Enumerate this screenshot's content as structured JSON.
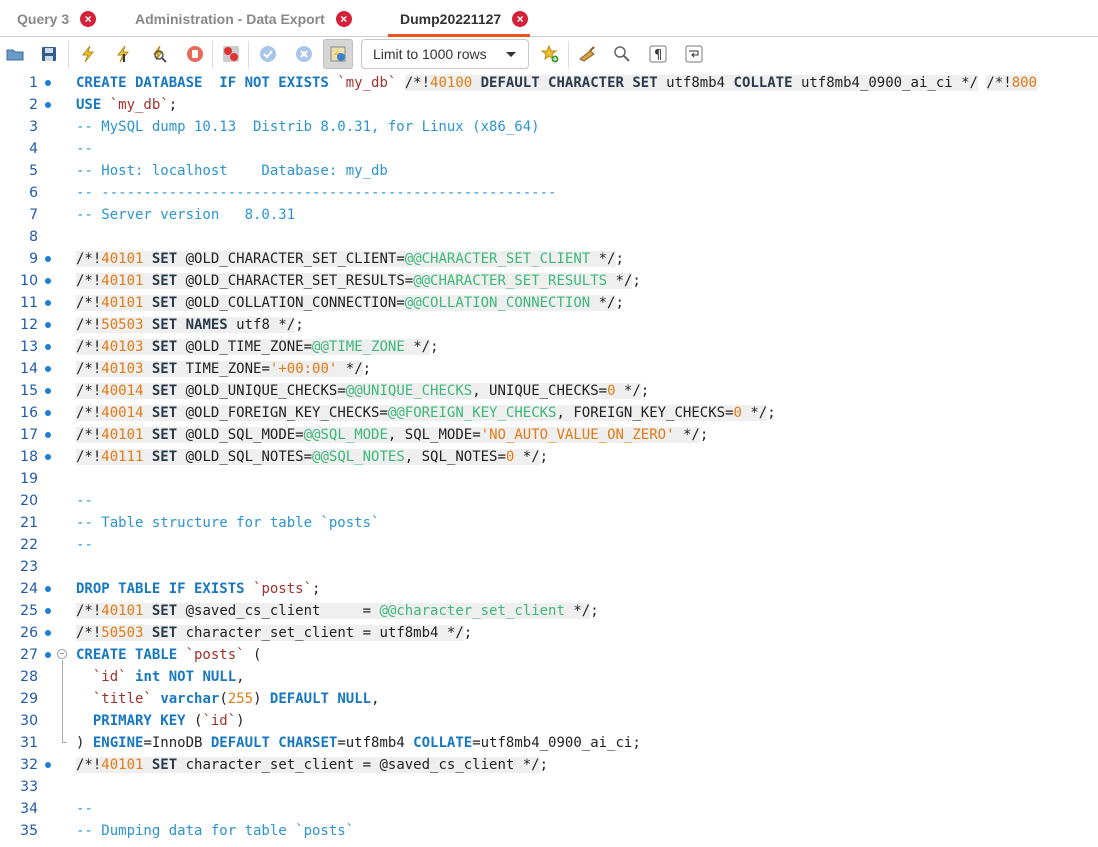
{
  "tabs": [
    {
      "label": "Query 3",
      "active": false
    },
    {
      "label": "Administration - Data Export",
      "active": false
    },
    {
      "label": "Dump20221127",
      "active": true
    }
  ],
  "toolbar": {
    "icons": [
      "open-folder-icon",
      "save-icon",
      "execute-icon",
      "execute-current-icon",
      "explain-icon",
      "stop-icon",
      "toggle-error-stop-icon",
      "commit-icon",
      "rollback-icon",
      "autocommit-icon"
    ],
    "limit_label": "Limit to 1000 rows",
    "right_icons": [
      "add-snippet-icon",
      "beautify-icon",
      "find-icon",
      "invisible-chars-icon",
      "wrap-icon"
    ]
  },
  "editor": {
    "lines": [
      {
        "n": "1",
        "dot": true,
        "segs": [
          [
            "kw",
            "CREATE DATABASE  IF NOT EXISTS "
          ],
          [
            "str",
            "`my_db`"
          ],
          [
            "op",
            " "
          ],
          [
            "hlc",
            "/*!"
          ],
          [
            "hlv",
            "40100"
          ],
          [
            "hlk",
            " DEFAULT CHARACTER SET "
          ],
          [
            "hlp",
            "utf8mb4 "
          ],
          [
            "hlk",
            "COLLATE "
          ],
          [
            "hlp",
            "utf8mb4_0900_ai_ci */"
          ],
          [
            "op",
            " "
          ],
          [
            "hlc",
            "/*!"
          ],
          [
            "hlv",
            "800"
          ]
        ]
      },
      {
        "n": "2",
        "dot": true,
        "segs": [
          [
            "kw",
            "USE "
          ],
          [
            "str",
            "`my_db`"
          ],
          [
            "op",
            ";"
          ]
        ]
      },
      {
        "n": "3",
        "dot": false,
        "segs": [
          [
            "cm",
            "-- MySQL dump 10.13  Distrib 8.0.31, for Linux (x86_64)"
          ]
        ]
      },
      {
        "n": "4",
        "dot": false,
        "segs": [
          [
            "cm",
            "--"
          ]
        ]
      },
      {
        "n": "5",
        "dot": false,
        "segs": [
          [
            "cm",
            "-- Host: localhost    Database: my_db"
          ]
        ]
      },
      {
        "n": "6",
        "dot": false,
        "segs": [
          [
            "cm",
            "-- ------------------------------------------------------"
          ]
        ]
      },
      {
        "n": "7",
        "dot": false,
        "segs": [
          [
            "cm",
            "-- Server version\t8.0.31"
          ]
        ]
      },
      {
        "n": "8",
        "dot": false,
        "segs": []
      },
      {
        "n": "9",
        "dot": true,
        "segs": [
          [
            "hlc",
            "/*!"
          ],
          [
            "hlv",
            "40101"
          ],
          [
            "hlk",
            " SET "
          ],
          [
            "hlp",
            "@OLD_CHARACTER_SET_CLIENT="
          ],
          [
            "hls",
            "@@CHARACTER_SET_CLIENT"
          ],
          [
            "hlp",
            " */"
          ],
          [
            "op",
            ";"
          ]
        ]
      },
      {
        "n": "10",
        "dot": true,
        "segs": [
          [
            "hlc",
            "/*!"
          ],
          [
            "hlv",
            "40101"
          ],
          [
            "hlk",
            " SET "
          ],
          [
            "hlp",
            "@OLD_CHARACTER_SET_RESULTS="
          ],
          [
            "hls",
            "@@CHARACTER_SET_RESULTS"
          ],
          [
            "hlp",
            " */"
          ],
          [
            "op",
            ";"
          ]
        ]
      },
      {
        "n": "11",
        "dot": true,
        "segs": [
          [
            "hlc",
            "/*!"
          ],
          [
            "hlv",
            "40101"
          ],
          [
            "hlk",
            " SET "
          ],
          [
            "hlp",
            "@OLD_COLLATION_CONNECTION="
          ],
          [
            "hls",
            "@@COLLATION_CONNECTION"
          ],
          [
            "hlp",
            " */"
          ],
          [
            "op",
            ";"
          ]
        ]
      },
      {
        "n": "12",
        "dot": true,
        "segs": [
          [
            "hlc",
            "/*!"
          ],
          [
            "hlv",
            "50503"
          ],
          [
            "hlk",
            " SET NAMES "
          ],
          [
            "hlp",
            "utf8 */"
          ],
          [
            "op",
            ";"
          ]
        ]
      },
      {
        "n": "13",
        "dot": true,
        "segs": [
          [
            "hlc",
            "/*!"
          ],
          [
            "hlv",
            "40103"
          ],
          [
            "hlk",
            " SET "
          ],
          [
            "hlp",
            "@OLD_TIME_ZONE="
          ],
          [
            "hls",
            "@@TIME_ZONE"
          ],
          [
            "hlp",
            " */"
          ],
          [
            "op",
            ";"
          ]
        ]
      },
      {
        "n": "14",
        "dot": true,
        "segs": [
          [
            "hlc",
            "/*!"
          ],
          [
            "hlv",
            "40103"
          ],
          [
            "hlk",
            " SET "
          ],
          [
            "hlp",
            "TIME_ZONE="
          ],
          [
            "hlv",
            "'+00:00'"
          ],
          [
            "hlp",
            " */"
          ],
          [
            "op",
            ";"
          ]
        ]
      },
      {
        "n": "15",
        "dot": true,
        "segs": [
          [
            "hlc",
            "/*!"
          ],
          [
            "hlv",
            "40014"
          ],
          [
            "hlk",
            " SET "
          ],
          [
            "hlp",
            "@OLD_UNIQUE_CHECKS="
          ],
          [
            "hls",
            "@@UNIQUE_CHECKS"
          ],
          [
            "hlp",
            ", UNIQUE_CHECKS="
          ],
          [
            "hlv",
            "0"
          ],
          [
            "hlp",
            " */"
          ],
          [
            "op",
            ";"
          ]
        ]
      },
      {
        "n": "16",
        "dot": true,
        "segs": [
          [
            "hlc",
            "/*!"
          ],
          [
            "hlv",
            "40014"
          ],
          [
            "hlk",
            " SET "
          ],
          [
            "hlp",
            "@OLD_FOREIGN_KEY_CHECKS="
          ],
          [
            "hls",
            "@@FOREIGN_KEY_CHECKS"
          ],
          [
            "hlp",
            ", FOREIGN_KEY_CHECKS="
          ],
          [
            "hlv",
            "0"
          ],
          [
            "hlp",
            " */"
          ],
          [
            "op",
            ";"
          ]
        ]
      },
      {
        "n": "17",
        "dot": true,
        "segs": [
          [
            "hlc",
            "/*!"
          ],
          [
            "hlv",
            "40101"
          ],
          [
            "hlk",
            " SET "
          ],
          [
            "hlp",
            "@OLD_SQL_MODE="
          ],
          [
            "hls",
            "@@SQL_MODE"
          ],
          [
            "hlp",
            ", SQL_MODE="
          ],
          [
            "hlv",
            "'NO_AUTO_VALUE_ON_ZERO'"
          ],
          [
            "hlp",
            " */"
          ],
          [
            "op",
            ";"
          ]
        ]
      },
      {
        "n": "18",
        "dot": true,
        "segs": [
          [
            "hlc",
            "/*!"
          ],
          [
            "hlv",
            "40111"
          ],
          [
            "hlk",
            " SET "
          ],
          [
            "hlp",
            "@OLD_SQL_NOTES="
          ],
          [
            "hls",
            "@@SQL_NOTES"
          ],
          [
            "hlp",
            ", SQL_NOTES="
          ],
          [
            "hlv",
            "0"
          ],
          [
            "hlp",
            " */"
          ],
          [
            "op",
            ";"
          ]
        ]
      },
      {
        "n": "19",
        "dot": false,
        "segs": []
      },
      {
        "n": "20",
        "dot": false,
        "segs": [
          [
            "cm",
            "--"
          ]
        ]
      },
      {
        "n": "21",
        "dot": false,
        "segs": [
          [
            "cm",
            "-- Table structure for table `posts`"
          ]
        ]
      },
      {
        "n": "22",
        "dot": false,
        "segs": [
          [
            "cm",
            "--"
          ]
        ]
      },
      {
        "n": "23",
        "dot": false,
        "segs": []
      },
      {
        "n": "24",
        "dot": true,
        "segs": [
          [
            "kw",
            "DROP TABLE IF EXISTS "
          ],
          [
            "str",
            "`posts`"
          ],
          [
            "op",
            ";"
          ]
        ]
      },
      {
        "n": "25",
        "dot": true,
        "segs": [
          [
            "hlc",
            "/*!"
          ],
          [
            "hlv",
            "40101"
          ],
          [
            "hlk",
            " SET "
          ],
          [
            "hlp",
            "@saved_cs_client     = "
          ],
          [
            "hls",
            "@@character_set_client"
          ],
          [
            "hlp",
            " */"
          ],
          [
            "op",
            ";"
          ]
        ]
      },
      {
        "n": "26",
        "dot": true,
        "segs": [
          [
            "hlc",
            "/*!"
          ],
          [
            "hlv",
            "50503"
          ],
          [
            "hlk",
            " SET "
          ],
          [
            "hlp",
            "character_set_client = utf8mb4 */"
          ],
          [
            "op",
            ";"
          ]
        ]
      },
      {
        "n": "27",
        "dot": true,
        "fold": true,
        "segs": [
          [
            "kw",
            "CREATE TABLE "
          ],
          [
            "str",
            "`posts`"
          ],
          [
            "op",
            " ("
          ]
        ]
      },
      {
        "n": "28",
        "dot": false,
        "segs": [
          [
            "op",
            "  "
          ],
          [
            "str",
            "`id`"
          ],
          [
            "op",
            " "
          ],
          [
            "kw",
            "int NOT NULL"
          ],
          [
            "op",
            ","
          ]
        ]
      },
      {
        "n": "29",
        "dot": false,
        "segs": [
          [
            "op",
            "  "
          ],
          [
            "str",
            "`title`"
          ],
          [
            "op",
            " "
          ],
          [
            "kw",
            "varchar"
          ],
          [
            "op",
            "("
          ],
          [
            "num",
            "255"
          ],
          [
            "op",
            ") "
          ],
          [
            "kw",
            "DEFAULT NULL"
          ],
          [
            "op",
            ","
          ]
        ]
      },
      {
        "n": "30",
        "dot": false,
        "segs": [
          [
            "op",
            "  "
          ],
          [
            "kw",
            "PRIMARY KEY"
          ],
          [
            "op",
            " ("
          ],
          [
            "str",
            "`id`"
          ],
          [
            "op",
            ")"
          ]
        ]
      },
      {
        "n": "31",
        "dot": false,
        "segs": [
          [
            "op",
            ") "
          ],
          [
            "kw",
            "ENGINE"
          ],
          [
            "op",
            "=InnoDB "
          ],
          [
            "kw",
            "DEFAULT CHARSET"
          ],
          [
            "op",
            "=utf8mb4 "
          ],
          [
            "kw",
            "COLLATE"
          ],
          [
            "op",
            "=utf8mb4_0900_ai_ci;"
          ]
        ]
      },
      {
        "n": "32",
        "dot": true,
        "segs": [
          [
            "hlc",
            "/*!"
          ],
          [
            "hlv",
            "40101"
          ],
          [
            "hlk",
            " SET "
          ],
          [
            "hlp",
            "character_set_client = @saved_cs_client */"
          ],
          [
            "op",
            ";"
          ]
        ]
      },
      {
        "n": "33",
        "dot": false,
        "segs": []
      },
      {
        "n": "34",
        "dot": false,
        "segs": [
          [
            "cm",
            "--"
          ]
        ]
      },
      {
        "n": "35",
        "dot": false,
        "segs": [
          [
            "cm",
            "-- Dumping data for table `posts`"
          ]
        ]
      }
    ]
  }
}
